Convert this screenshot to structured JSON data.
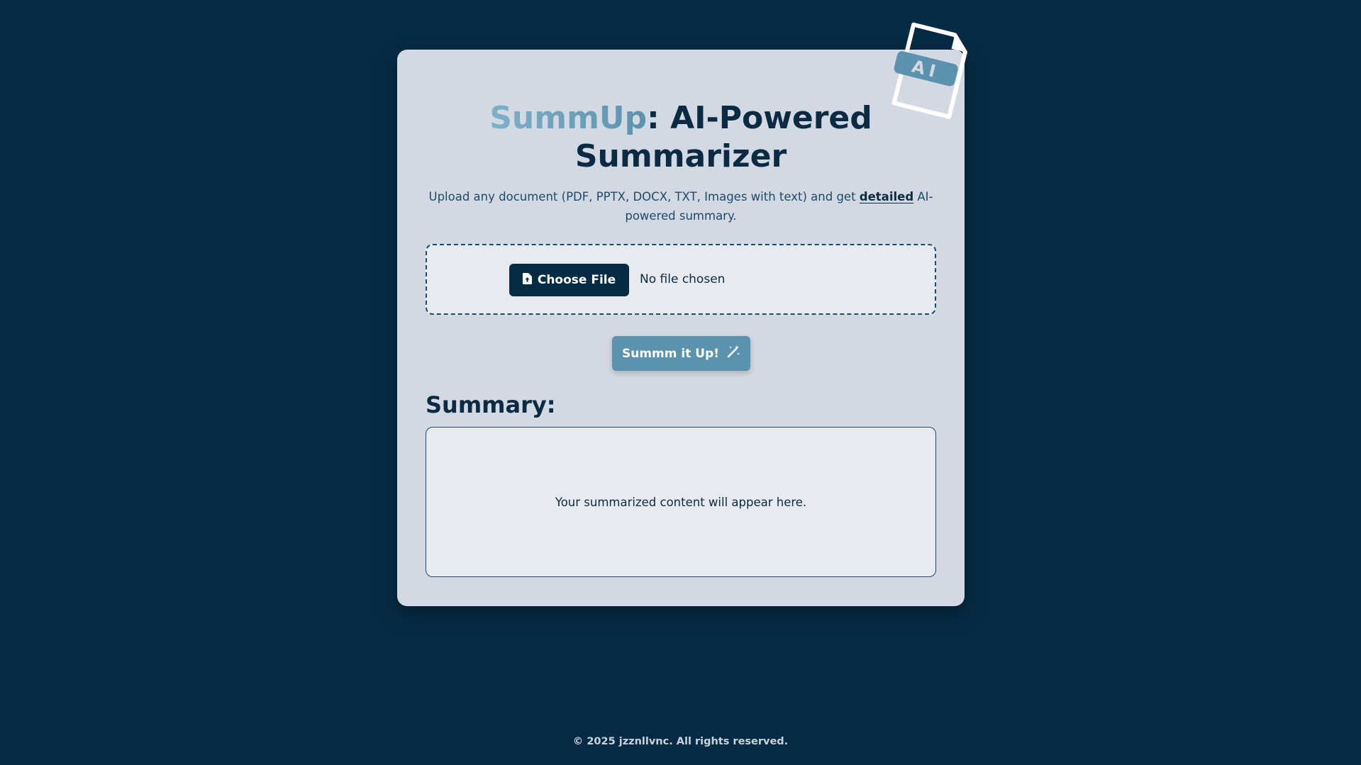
{
  "header": {
    "title_brand": "SummUp",
    "title_rest": ": AI-Powered Summarizer",
    "subtitle_before": "Upload any document (PDF, PPTX, DOCX, TXT, Images with text) and get ",
    "subtitle_emphasis": "detailed",
    "subtitle_after": " AI-powered summary.",
    "badge_text": "AI"
  },
  "upload": {
    "choose_label": "Choose File",
    "status": "No file chosen"
  },
  "action": {
    "summarize_label": "Summm it Up!"
  },
  "summary": {
    "heading": "Summary:",
    "placeholder": "Your summarized content will appear here."
  },
  "footer": {
    "copyright": "© 2025 jzznllvnc. All rights reserved."
  },
  "icons": {
    "badge": "ai-document-icon",
    "upload": "file-upload-icon",
    "action": "magic-wand-icon"
  },
  "colors": {
    "background": "#072b44",
    "card": "#d3d9e2",
    "primary": "#072b44",
    "accent": "#5b93ae",
    "panel": "#e7eaef"
  }
}
